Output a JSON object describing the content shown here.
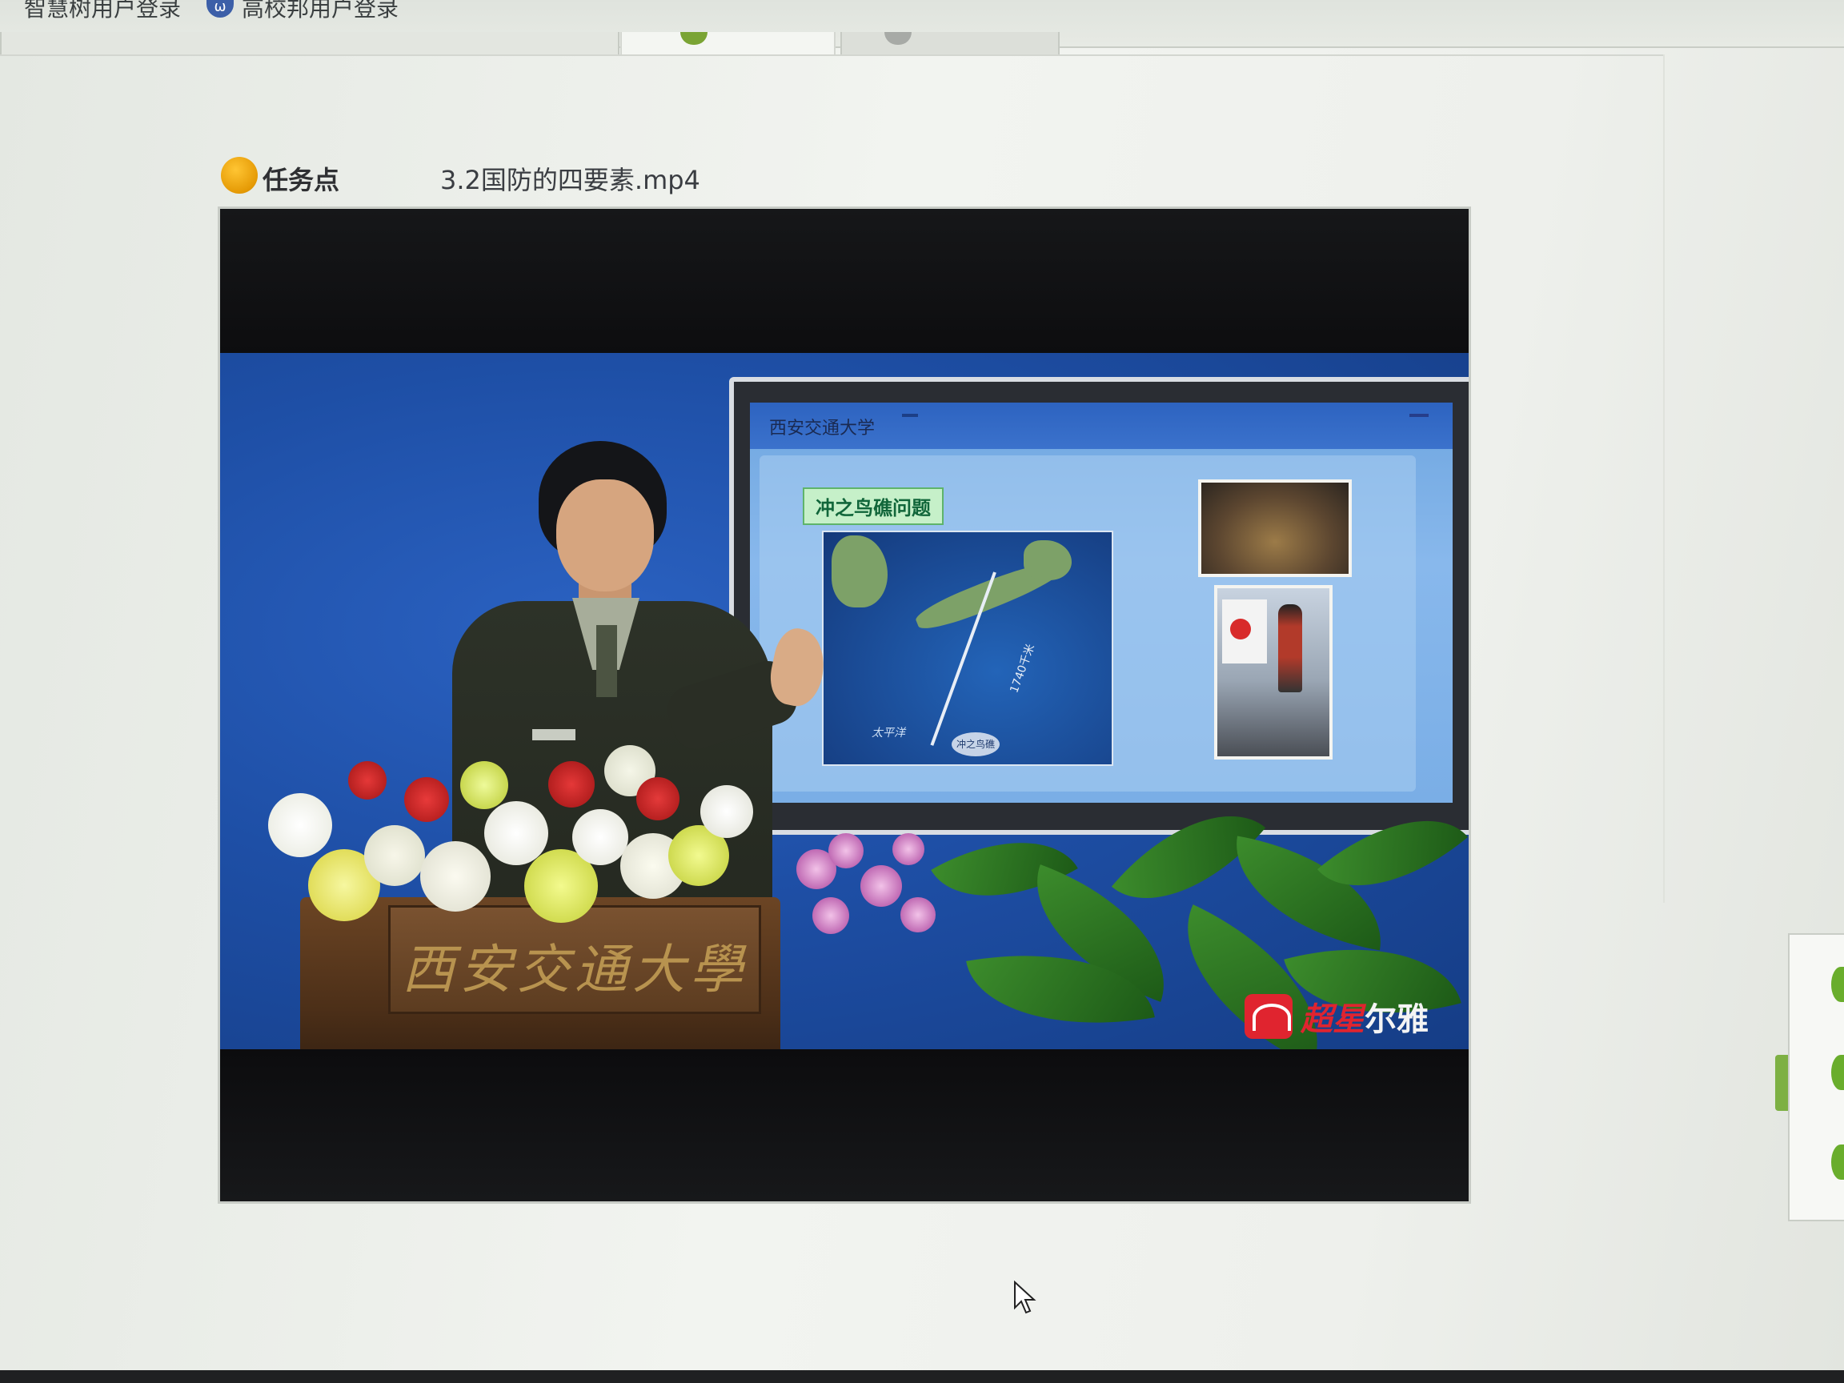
{
  "browser": {
    "bookmarks": [
      {
        "label": "智慧树用户登录",
        "icon": "zhihuishu-icon"
      },
      {
        "label": "高校邦用户登录",
        "icon": "gaoxiaobang-icon"
      }
    ],
    "bookmark_icon_glyph": "ω"
  },
  "task": {
    "label": "任务点",
    "file_name": "3.2国防的四要素.mp4",
    "status_color": "#f0a50a"
  },
  "video": {
    "slide": {
      "university": "西安交通大学",
      "title": "冲之鸟礁问题",
      "map_distance": "1740千米",
      "map_ocean": "太平洋",
      "map_island": "冲之鸟礁"
    },
    "podium_text": "西安交通大學",
    "watermark": {
      "brand_red": "超星",
      "brand_white": "尔雅"
    }
  },
  "colors": {
    "accent_orange": "#f0a50a",
    "video_background": "#1e4fa6",
    "watermark_red": "#e0242f"
  }
}
